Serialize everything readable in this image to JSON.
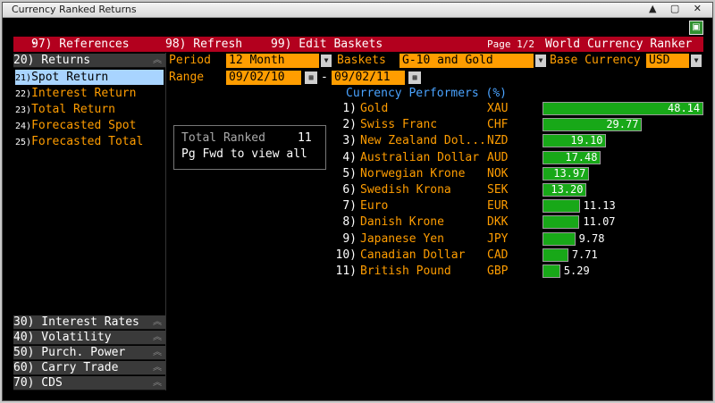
{
  "window": {
    "title": "Currency Ranked Returns",
    "controls": "▲ ▢ ✕"
  },
  "toolbar": {
    "references": "97) References",
    "refresh": "98) Refresh",
    "edit_baskets": "99) Edit Baskets",
    "page": "Page 1/2",
    "app_title": "World Currency Ranker"
  },
  "sidebar": {
    "returns": "20)    Returns",
    "items": [
      {
        "num": "21)",
        "label": "Spot Return"
      },
      {
        "num": "22)",
        "label": "Interest Return"
      },
      {
        "num": "23)",
        "label": "Total Return"
      },
      {
        "num": "24)",
        "label": "Forecasted Spot"
      },
      {
        "num": "25)",
        "label": "Forecasted Total"
      }
    ],
    "bottom": [
      "30)    Interest Rates",
      "40)    Volatility",
      "50)    Purch. Power",
      "60)    Carry Trade",
      "70)    CDS"
    ]
  },
  "controls": {
    "period_label": "Period",
    "period_value": "12 Month",
    "baskets_label": "Baskets",
    "baskets_value": "G-10 and Gold",
    "base_label": "Base Currency",
    "base_value": "USD",
    "range_label": "Range",
    "range_start": "09/02/10",
    "range_sep": "-",
    "range_end": "09/02/11"
  },
  "tooltip": {
    "label": "Total Ranked",
    "count": "11",
    "hint": "Pg Fwd to view all"
  },
  "chart_data": {
    "type": "bar",
    "title": "Currency Performers (%)",
    "rows": [
      {
        "rank": "1)",
        "name": "Gold",
        "code": "XAU",
        "value": 48.14,
        "label": "48.14"
      },
      {
        "rank": "2)",
        "name": "Swiss Franc",
        "code": "CHF",
        "value": 29.77,
        "label": "29.77"
      },
      {
        "rank": "3)",
        "name": "New Zealand Dol...",
        "code": "NZD",
        "value": 19.1,
        "label": "19.10"
      },
      {
        "rank": "4)",
        "name": "Australian Dollar",
        "code": "AUD",
        "value": 17.48,
        "label": "17.48"
      },
      {
        "rank": "5)",
        "name": "Norwegian Krone",
        "code": "NOK",
        "value": 13.97,
        "label": "13.97"
      },
      {
        "rank": "6)",
        "name": "Swedish Krona",
        "code": "SEK",
        "value": 13.2,
        "label": "13.20"
      },
      {
        "rank": "7)",
        "name": "Euro",
        "code": "EUR",
        "value": 11.13,
        "label": "11.13"
      },
      {
        "rank": "8)",
        "name": "Danish Krone",
        "code": "DKK",
        "value": 11.07,
        "label": "11.07"
      },
      {
        "rank": "9)",
        "name": "Japanese Yen",
        "code": "JPY",
        "value": 9.78,
        "label": "9.78"
      },
      {
        "rank": "10)",
        "name": "Canadian Dollar",
        "code": "CAD",
        "value": 7.71,
        "label": "7.71"
      },
      {
        "rank": "11)",
        "name": "British Pound",
        "code": "GBP",
        "value": 5.29,
        "label": "5.29"
      }
    ],
    "xlim": [
      0,
      48.14
    ]
  }
}
